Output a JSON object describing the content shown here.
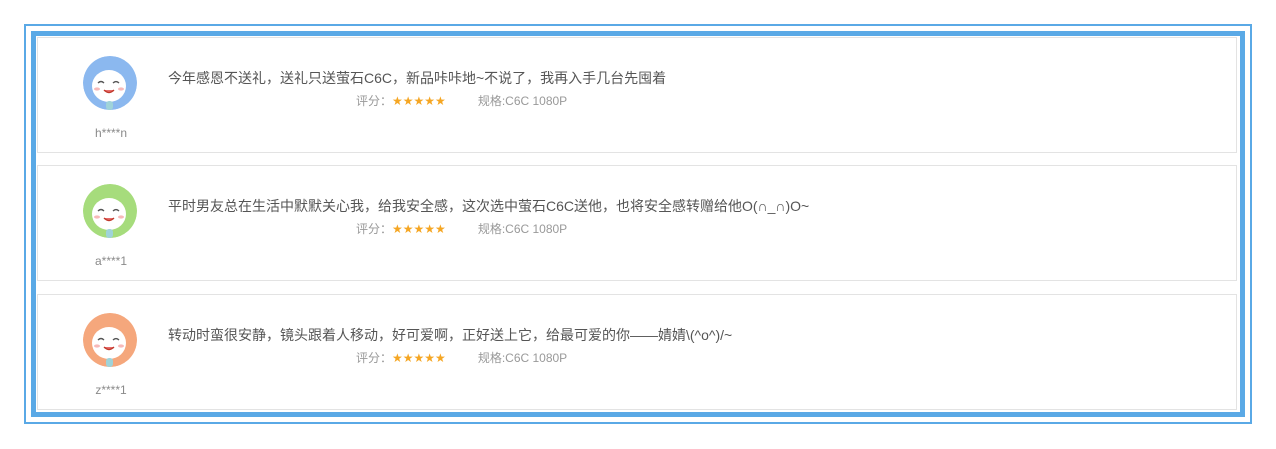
{
  "reviews": [
    {
      "user": "h****n",
      "avatar_color": "#8bb8ef",
      "comment": "今年感恩不送礼，送礼只送萤石C6C，新品咔咔地~不说了，我再入手几台先囤着",
      "rating_label": "评分：",
      "stars": "★★★★★",
      "rating": 5,
      "spec": "规格:C6C 1080P"
    },
    {
      "user": "a****1",
      "avatar_color": "#a6dc7c",
      "comment": "平时男友总在生活中默默关心我，给我安全感，这次选中萤石C6C送他，也将安全感转赠给他O(∩_∩)O~",
      "rating_label": "评分：",
      "stars": "★★★★★",
      "rating": 5,
      "spec": "规格:C6C 1080P"
    },
    {
      "user": "z****1",
      "avatar_color": "#f5a77c",
      "comment": "转动时蛮很安静，镜头跟着人移动，好可爱啊，正好送上它，给最可爱的你——婧婧\\(^o^)/~",
      "rating_label": "评分：",
      "stars": "★★★★★",
      "rating": 5,
      "spec": "规格:C6C 1080P"
    }
  ],
  "colors": {
    "frame": "#5aa9e6",
    "star": "#f5a623"
  }
}
